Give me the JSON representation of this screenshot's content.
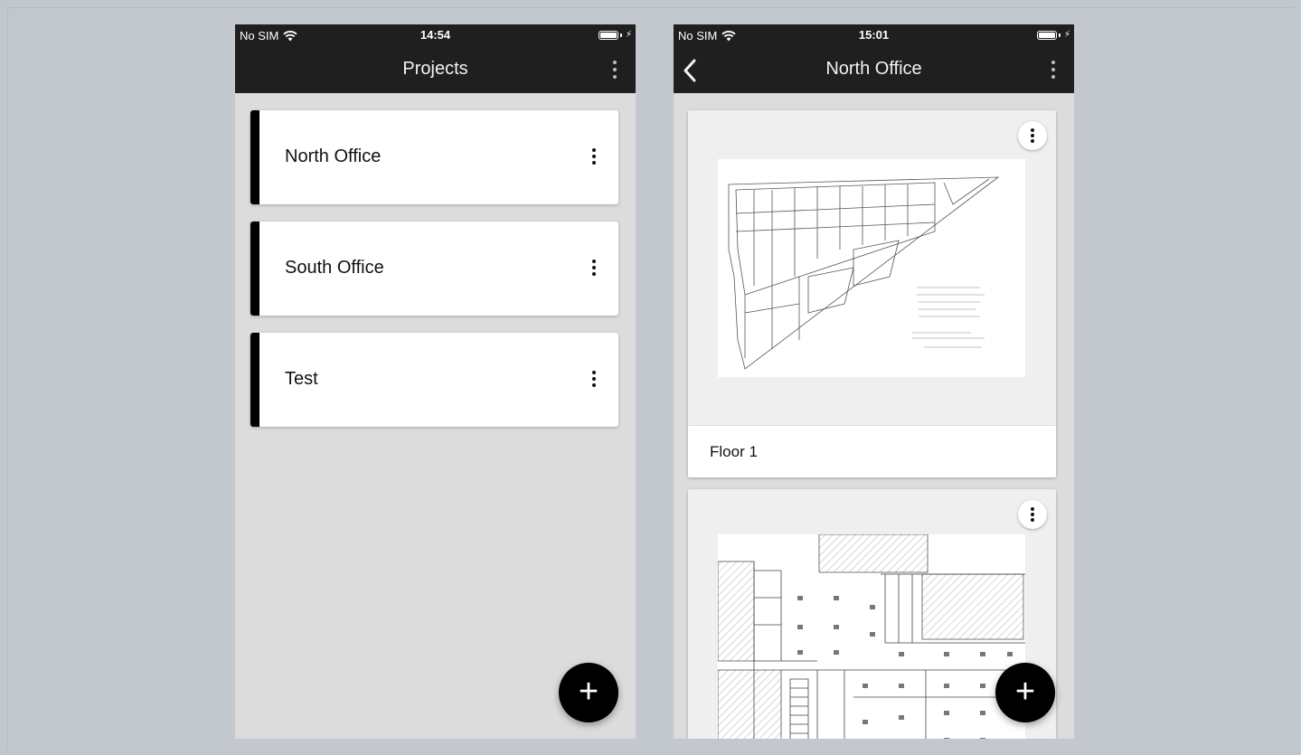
{
  "left_screen": {
    "status": {
      "carrier": "No SIM",
      "time": "14:54"
    },
    "nav": {
      "title": "Projects",
      "menu_icon": "more-vertical-icon"
    },
    "projects": [
      {
        "name": "North Office"
      },
      {
        "name": "South Office"
      },
      {
        "name": "Test"
      }
    ],
    "fab": {
      "label": "+"
    },
    "colors": {
      "accent": "#000000",
      "bar": "#1f1f1f",
      "background": "#dcdcdc"
    }
  },
  "right_screen": {
    "status": {
      "carrier": "No SIM",
      "time": "15:01"
    },
    "nav": {
      "title": "North Office",
      "back_icon": "chevron-left-icon",
      "menu_icon": "more-vertical-icon"
    },
    "floorplans": [
      {
        "name": "Floor 1"
      },
      {
        "name": ""
      }
    ],
    "fab": {
      "label": "+"
    }
  }
}
